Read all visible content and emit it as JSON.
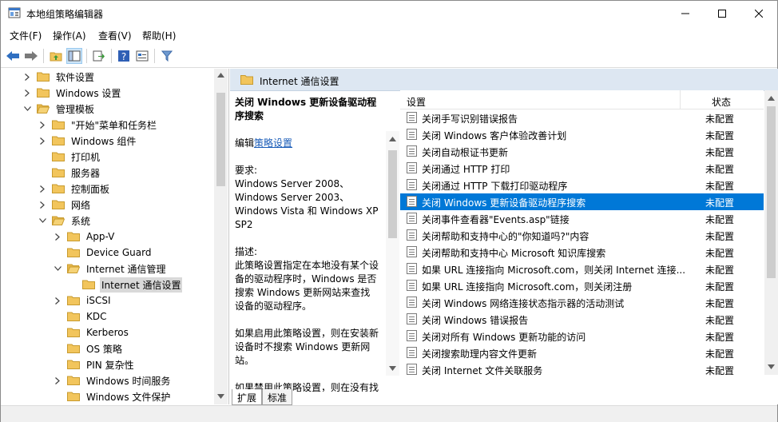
{
  "window": {
    "title": "本地组策略编辑器"
  },
  "menu": [
    "文件(F)",
    "操作(A)",
    "查看(V)",
    "帮助(H)"
  ],
  "tree": [
    {
      "label": "软件设置",
      "level": 1,
      "expanded": false
    },
    {
      "label": "Windows 设置",
      "level": 1,
      "expanded": false
    },
    {
      "label": "管理模板",
      "level": 1,
      "expanded": true
    },
    {
      "label": "\"开始\"菜单和任务栏",
      "level": 2,
      "expanded": false
    },
    {
      "label": "Windows 组件",
      "level": 2,
      "expanded": false
    },
    {
      "label": "打印机",
      "level": 2,
      "expanded": null
    },
    {
      "label": "服务器",
      "level": 2,
      "expanded": null
    },
    {
      "label": "控制面板",
      "level": 2,
      "expanded": false
    },
    {
      "label": "网络",
      "level": 2,
      "expanded": false
    },
    {
      "label": "系统",
      "level": 2,
      "expanded": true
    },
    {
      "label": "App-V",
      "level": 3,
      "expanded": false
    },
    {
      "label": "Device Guard",
      "level": 3,
      "expanded": null
    },
    {
      "label": "Internet 通信管理",
      "level": 3,
      "expanded": true
    },
    {
      "label": "Internet 通信设置",
      "level": 4,
      "expanded": null,
      "selected": true
    },
    {
      "label": "iSCSI",
      "level": 3,
      "expanded": false
    },
    {
      "label": "KDC",
      "level": 3,
      "expanded": null
    },
    {
      "label": "Kerberos",
      "level": 3,
      "expanded": null
    },
    {
      "label": "OS 策略",
      "level": 3,
      "expanded": null
    },
    {
      "label": "PIN 复杂性",
      "level": 3,
      "expanded": null
    },
    {
      "label": "Windows 时间服务",
      "level": 3,
      "expanded": false
    },
    {
      "label": "Windows 文件保护",
      "level": 3,
      "expanded": null
    }
  ],
  "pane": {
    "header": "Internet 通信设置",
    "desc_title": "关闭 Windows 更新设备驱动程序搜索",
    "edit_prefix": "编辑",
    "edit_link": "策略设置",
    "req_label": "要求:",
    "req_text": "Windows Server 2008、Windows Server 2003、Windows Vista 和 Windows XP SP2",
    "desc_label": "描述:",
    "desc_text1": "此策略设置指定在本地没有某个设备的驱动程序时，Windows 是否搜索 Windows 更新网站来查找设备的驱动程序。",
    "desc_text2": "如果启用此策略设置，则在安装新设备时不搜索 Windows 更新网站。",
    "desc_text3": "如果禁用此策略设置，则在没有找"
  },
  "list": {
    "col_setting": "设置",
    "col_state": "状态",
    "selected_index": 5,
    "rows": [
      {
        "name": "关闭手写识别错误报告",
        "state": "未配置"
      },
      {
        "name": "关闭 Windows 客户体验改善计划",
        "state": "未配置"
      },
      {
        "name": "关闭自动根证书更新",
        "state": "未配置"
      },
      {
        "name": "关闭通过 HTTP 打印",
        "state": "未配置"
      },
      {
        "name": "关闭通过 HTTP 下载打印驱动程序",
        "state": "未配置"
      },
      {
        "name": "关闭 Windows 更新设备驱动程序搜索",
        "state": "未配置"
      },
      {
        "name": "关闭事件查看器\"Events.asp\"链接",
        "state": "未配置"
      },
      {
        "name": "关闭帮助和支持中心的\"你知道吗?\"内容",
        "state": "未配置"
      },
      {
        "name": "关闭帮助和支持中心 Microsoft 知识库搜索",
        "state": "未配置"
      },
      {
        "name": "如果 URL 连接指向 Microsoft.com，则关闭 Internet 连接...",
        "state": "未配置"
      },
      {
        "name": "如果 URL 连接指向 Microsoft.com，则关闭注册",
        "state": "未配置"
      },
      {
        "name": "关闭 Windows 网络连接状态指示器的活动测试",
        "state": "未配置"
      },
      {
        "name": "关闭 Windows 错误报告",
        "state": "未配置"
      },
      {
        "name": "关闭对所有 Windows 更新功能的访问",
        "state": "未配置"
      },
      {
        "name": "关闭搜索助理内容文件更新",
        "state": "未配置"
      },
      {
        "name": "关闭 Internet 文件关联服务",
        "state": "未配置"
      }
    ]
  },
  "tabs": [
    "扩展",
    "标准"
  ],
  "colors": {
    "selection": "#0078d7",
    "header_bg": "#dde7f2",
    "folder": "#f2c55c"
  }
}
